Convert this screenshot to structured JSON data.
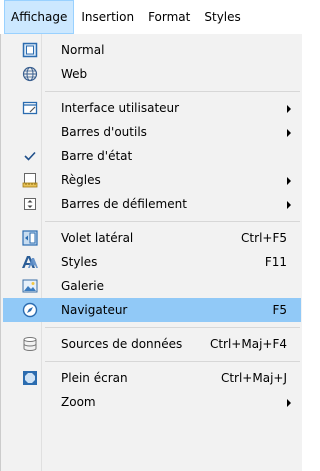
{
  "menubar": {
    "items": [
      {
        "label": "Affichage",
        "open": true
      },
      {
        "label": "Insertion"
      },
      {
        "label": "Format"
      },
      {
        "label": "Styles"
      }
    ]
  },
  "menu": {
    "items": [
      {
        "label": "Normal",
        "icon": "page-icon",
        "shortcut": "",
        "submenu": false
      },
      {
        "label": "Web",
        "icon": "globe-icon",
        "shortcut": "",
        "submenu": false
      },
      {
        "label": "Interface utilisateur",
        "icon": "window-icon",
        "shortcut": "",
        "submenu": true
      },
      {
        "label": "Barres d'outils",
        "icon": "",
        "shortcut": "",
        "submenu": true
      },
      {
        "label": "Barre d'état",
        "icon": "check-icon",
        "shortcut": "",
        "submenu": false
      },
      {
        "label": "Règles",
        "icon": "ruler-icon",
        "shortcut": "",
        "submenu": true
      },
      {
        "label": "Barres de défilement",
        "icon": "scrollbar-icon",
        "shortcut": "",
        "submenu": true
      },
      {
        "label": "Volet latéral",
        "icon": "sidebar-icon",
        "shortcut": "Ctrl+F5",
        "submenu": false
      },
      {
        "label": "Styles",
        "icon": "styles-icon",
        "shortcut": "F11",
        "submenu": false
      },
      {
        "label": "Galerie",
        "icon": "gallery-icon",
        "shortcut": "",
        "submenu": false
      },
      {
        "label": "Navigateur",
        "icon": "navigator-icon",
        "shortcut": "F5",
        "submenu": false,
        "highlighted": true
      },
      {
        "label": "Sources de données",
        "icon": "database-icon",
        "shortcut": "Ctrl+Maj+F4",
        "submenu": false
      },
      {
        "label": "Plein écran",
        "icon": "fullscreen-icon",
        "shortcut": "Ctrl+Maj+J",
        "submenu": false
      },
      {
        "label": "Zoom",
        "icon": "",
        "shortcut": "",
        "submenu": true
      }
    ]
  }
}
